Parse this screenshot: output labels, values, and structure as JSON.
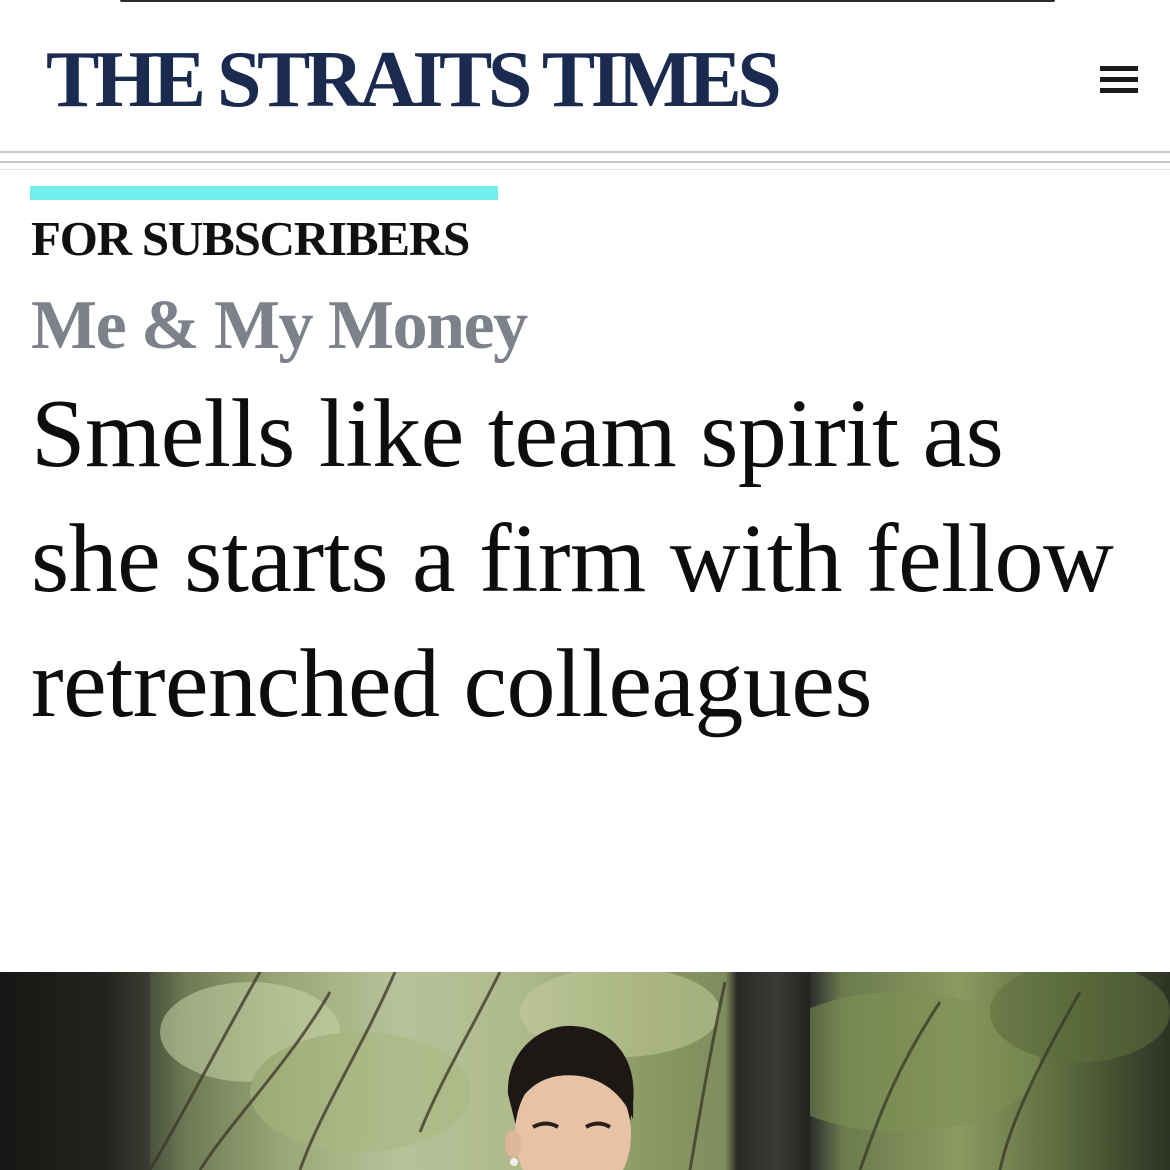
{
  "header": {
    "logo_text": "THE STRAITS TIMES",
    "menu_icon": "hamburger-menu-icon"
  },
  "article": {
    "kicker": "FOR SUBSCRIBERS",
    "section": "Me & My Money",
    "headline": "Smells like team spirit as she starts a firm with fellow retrenched colleagues"
  },
  "colors": {
    "logo": "#1a2b4f",
    "accent_bar": "#6ff0ef",
    "section": "#7c818a",
    "text": "#0d0d0d"
  }
}
